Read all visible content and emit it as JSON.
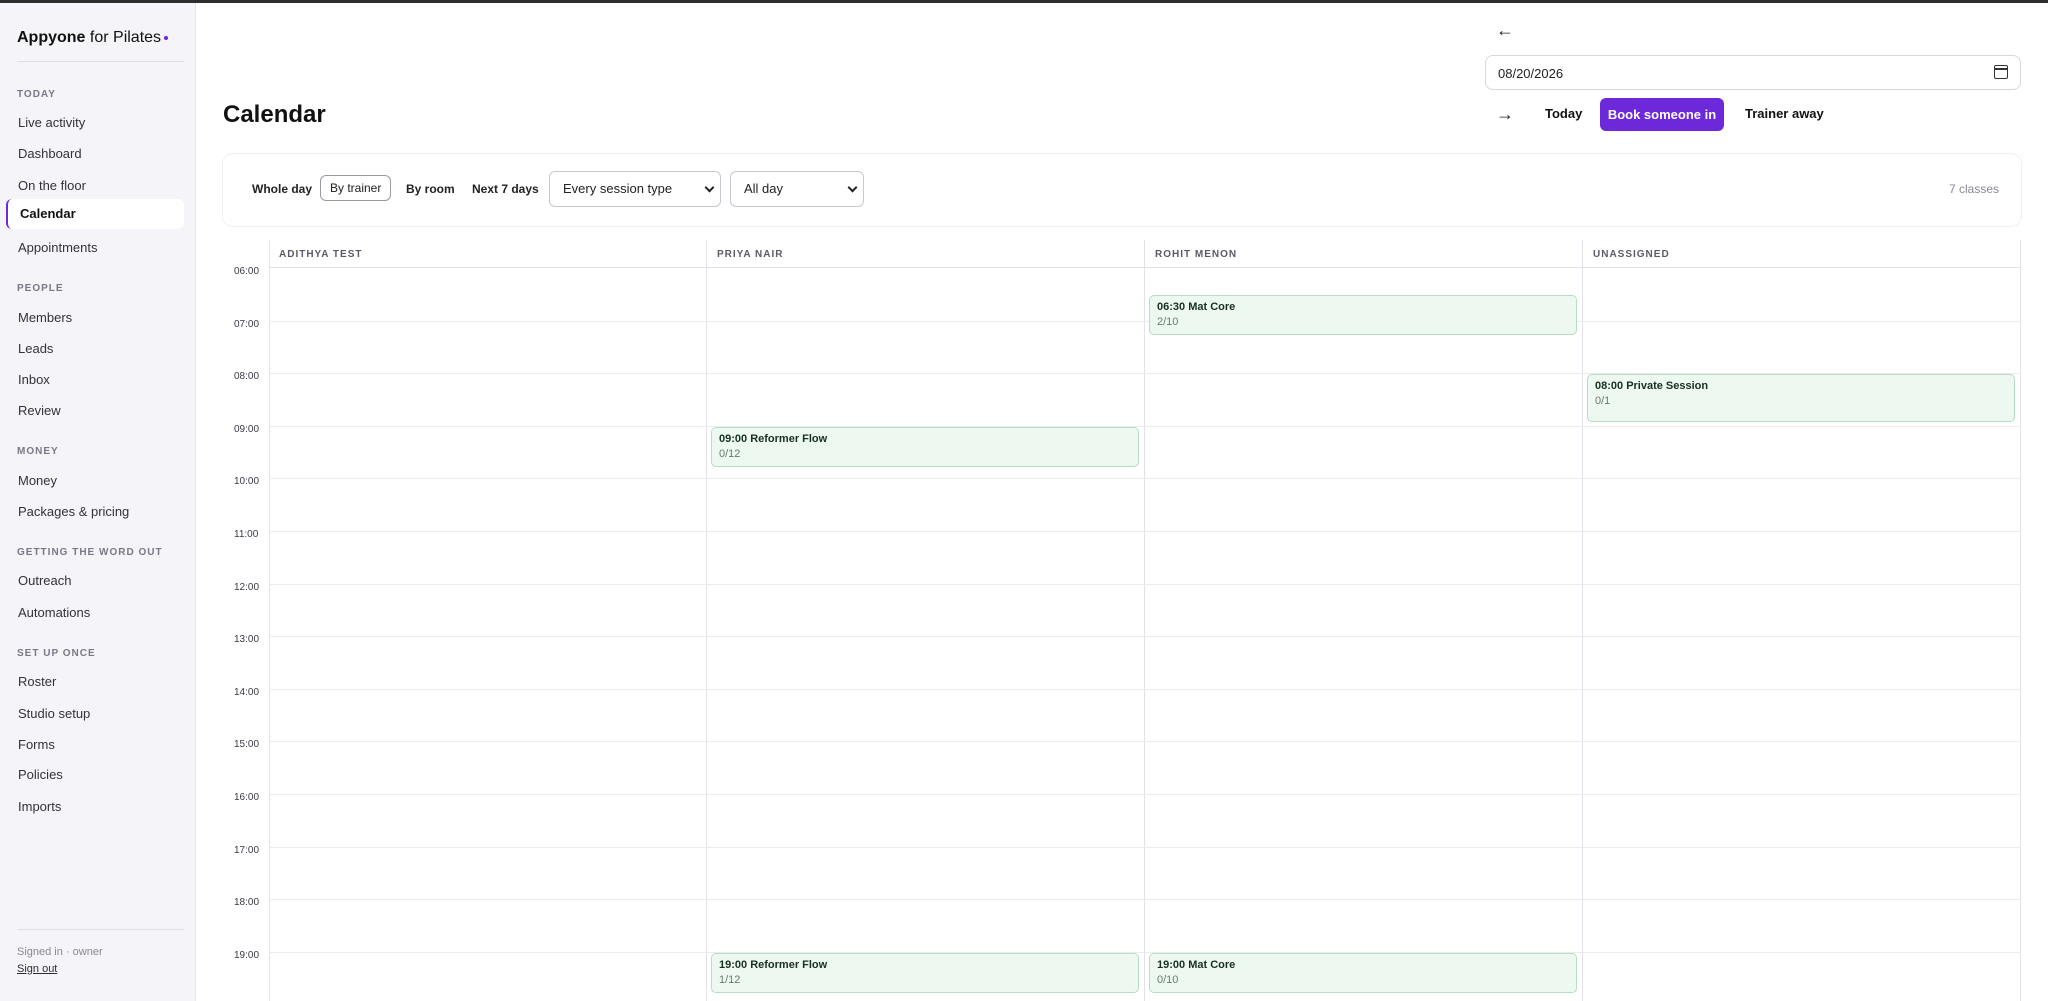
{
  "app": {
    "brand_bold": "Appyone",
    "brand_rest": " for Pilates"
  },
  "sidebar": {
    "sections": [
      {
        "label": "TODAY",
        "items": [
          "Live activity",
          "Dashboard",
          "On the floor",
          "Calendar",
          "Appointments"
        ]
      },
      {
        "label": "PEOPLE",
        "items": [
          "Members",
          "Leads",
          "Inbox",
          "Review"
        ]
      },
      {
        "label": "MONEY",
        "items": [
          "Money",
          "Packages & pricing"
        ]
      },
      {
        "label": "GETTING THE WORD OUT",
        "items": [
          "Outreach",
          "Automations"
        ]
      },
      {
        "label": "SET UP ONCE",
        "items": [
          "Roster",
          "Studio setup",
          "Forms",
          "Policies",
          "Imports"
        ]
      }
    ],
    "active_item": "Calendar",
    "signed_in": "Signed in · owner",
    "sign_out": "Sign out"
  },
  "header": {
    "title": "Calendar",
    "prev_arrow": "←",
    "next_arrow": "→",
    "date_value": "08/20/2026",
    "today_label": "Today",
    "book_label": "Book someone in",
    "away_label": "Trainer away"
  },
  "toolbar": {
    "whole_day": "Whole day",
    "by_trainer": "By trainer",
    "by_room": "By room",
    "next_7_days": "Next 7 days",
    "session_type": "Every session type",
    "time_range": "All day",
    "class_count": "7 classes"
  },
  "calendar": {
    "columns": [
      "ADITHYA TEST",
      "PRIYA NAIR",
      "ROHIT MENON",
      "UNASSIGNED"
    ],
    "hours": [
      "06:00",
      "07:00",
      "08:00",
      "09:00",
      "10:00",
      "11:00",
      "12:00",
      "13:00",
      "14:00",
      "15:00",
      "16:00",
      "17:00",
      "18:00",
      "19:00"
    ],
    "events": [
      {
        "column": 2,
        "start": "06:30",
        "title": "06:30 Mat Core",
        "capacity": "2/10"
      },
      {
        "column": 3,
        "start": "08:00",
        "title": "08:00 Private Session",
        "capacity": "0/1"
      },
      {
        "column": 1,
        "start": "09:00",
        "title": "09:00 Reformer Flow",
        "capacity": "0/12"
      },
      {
        "column": 1,
        "start": "19:00",
        "title": "19:00 Reformer Flow",
        "capacity": "1/12"
      },
      {
        "column": 2,
        "start": "19:00",
        "title": "19:00 Mat Core",
        "capacity": "0/10"
      }
    ]
  },
  "colors": {
    "accent": "#6d28d9",
    "event_bg": "#edf8f1",
    "event_border": "#b8dcc4"
  }
}
